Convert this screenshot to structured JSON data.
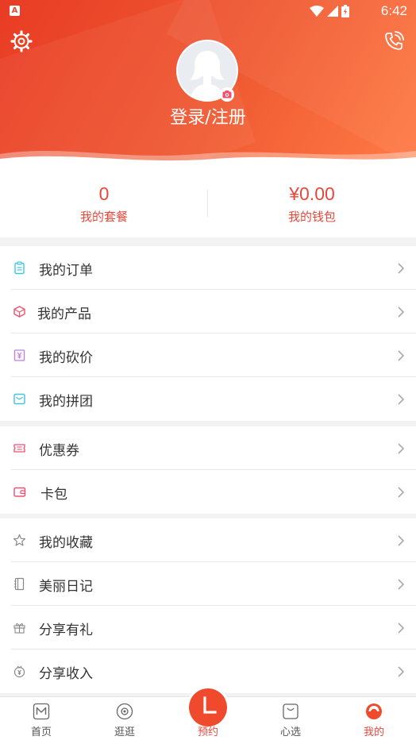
{
  "status_bar": {
    "app_badge": "A",
    "time": "6:42"
  },
  "header": {
    "login_label": "登录/注册"
  },
  "stats": [
    {
      "value": "0",
      "label": "我的套餐"
    },
    {
      "value": "¥0.00",
      "label": "我的钱包"
    }
  ],
  "menu_groups": [
    [
      {
        "label": "我的订单",
        "icon": "clipboard-icon",
        "color": "#3ec6e0"
      },
      {
        "label": "我的产品",
        "icon": "box-icon",
        "color": "#f0506e"
      },
      {
        "label": "我的砍价",
        "icon": "price-tag-icon",
        "color": "#c27be0"
      },
      {
        "label": "我的拼团",
        "icon": "group-buy-icon",
        "color": "#3ec6e0"
      }
    ],
    [
      {
        "label": "优惠券",
        "icon": "coupon-icon",
        "color": "#f0506e"
      },
      {
        "label": "卡包",
        "icon": "wallet-card-icon",
        "color": "#f0506e"
      }
    ],
    [
      {
        "label": "我的收藏",
        "icon": "star-icon",
        "color": "#888888"
      },
      {
        "label": "美丽日记",
        "icon": "notebook-icon",
        "color": "#888888"
      },
      {
        "label": "分享有礼",
        "icon": "gift-icon",
        "color": "#888888"
      },
      {
        "label": "分享收入",
        "icon": "income-icon",
        "color": "#888888"
      }
    ]
  ],
  "tabbar": {
    "tabs": [
      {
        "label": "首页",
        "icon": "home-m-icon"
      },
      {
        "label": "逛逛",
        "icon": "browse-icon"
      },
      {
        "label": "预约",
        "icon": "clock-icon"
      },
      {
        "label": "心选",
        "icon": "shopping-bag-icon"
      },
      {
        "label": "我的",
        "icon": "profile-icon"
      }
    ],
    "active_index": 4
  },
  "colors": {
    "brand": "#f04a2e",
    "accent_text": "#e8483b"
  }
}
